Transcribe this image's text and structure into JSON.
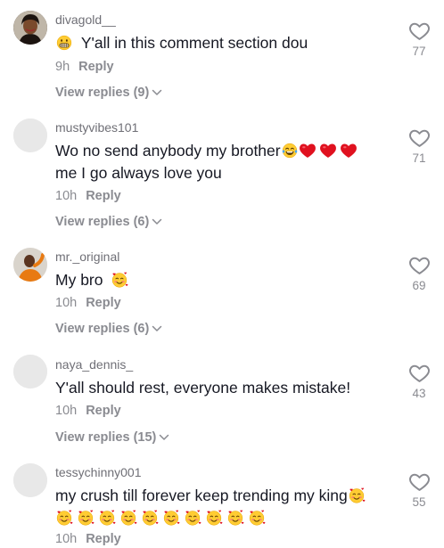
{
  "colors": {
    "text": "#161823",
    "muted": "#8a8b91",
    "username": "#6f6f76",
    "heart_red": "#e0111f",
    "emoji_face": "#ffcc33"
  },
  "comments": [
    {
      "username": "divagold__",
      "text": "Y'all in this comment section dou",
      "time": "9h",
      "reply": "Reply",
      "view_replies": "View replies (9)",
      "likes": "77",
      "avatar_icon": "profile-photo"
    },
    {
      "username": "mustyvibes101",
      "text_line1": "Wo no send anybody my brother",
      "text_line2": "me I go always love you",
      "time": "10h",
      "reply": "Reply",
      "view_replies": "View replies (6)",
      "likes": "71",
      "avatar_icon": "default-avatar"
    },
    {
      "username": "mr._original",
      "text": "My bro",
      "time": "10h",
      "reply": "Reply",
      "view_replies": "View replies (6)",
      "likes": "69",
      "avatar_icon": "profile-photo"
    },
    {
      "username": "naya_dennis_",
      "text": "Y'all should rest, everyone makes mistake!",
      "time": "10h",
      "reply": "Reply",
      "view_replies": "View replies (15)",
      "likes": "43",
      "avatar_icon": "default-avatar"
    },
    {
      "username": "tessychinny001",
      "text": "my crush till forever keep trending my king",
      "time": "10h",
      "reply": "Reply",
      "likes": "55",
      "avatar_icon": "default-avatar"
    }
  ]
}
